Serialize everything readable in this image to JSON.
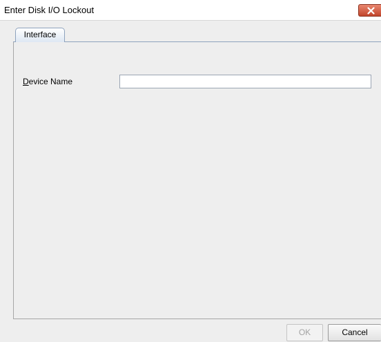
{
  "window": {
    "title": "Enter Disk I/O Lockout",
    "close_icon": "close-icon"
  },
  "tabs": [
    {
      "label": "Interface",
      "selected": true
    }
  ],
  "form": {
    "device_name": {
      "label_mnemonic": "D",
      "label_rest": "evice Name",
      "value": ""
    }
  },
  "buttons": {
    "ok_label": "OK",
    "ok_enabled": false,
    "cancel_label": "Cancel"
  },
  "colors": {
    "close_button": "#c2462c",
    "tab_border": "#8da2bd",
    "dialog_background": "#eeeeee"
  }
}
